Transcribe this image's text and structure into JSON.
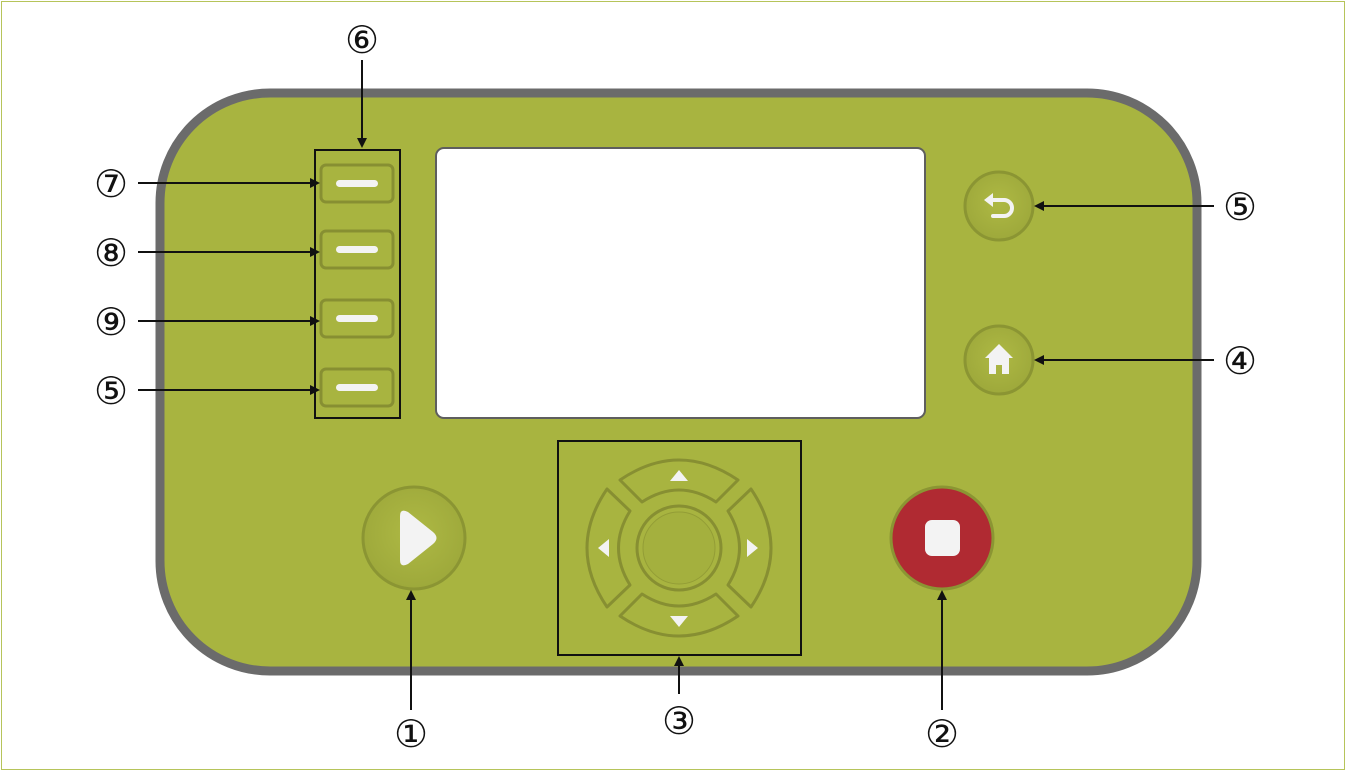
{
  "colors": {
    "panel_fill": "#a8b440",
    "panel_border": "#6b6b6b",
    "button_fill": "#a8b440",
    "button_edge": "#8b9533",
    "screen_fill": "#ffffff",
    "stop_button": "#b02a32",
    "glyph": "#f3f3f3",
    "callout_line": "#111111"
  },
  "icons": {
    "start": "play-icon",
    "stop": "stop-icon",
    "back": "return-arrow-icon",
    "home": "home-icon",
    "nav_up": "triangle-up-icon",
    "nav_down": "triangle-down-icon",
    "nav_left": "triangle-left-icon",
    "nav_right": "triangle-right-icon",
    "soft_key": "dash-icon"
  },
  "callouts": {
    "start_button": "①",
    "stop_button": "②",
    "nav_pad": "③",
    "home_button": "④",
    "back_button": "⑤",
    "soft_key_group": "⑥",
    "soft_key_1": "⑦",
    "soft_key_2": "⑧",
    "soft_key_3": "⑨",
    "soft_key_4": "⑤"
  }
}
